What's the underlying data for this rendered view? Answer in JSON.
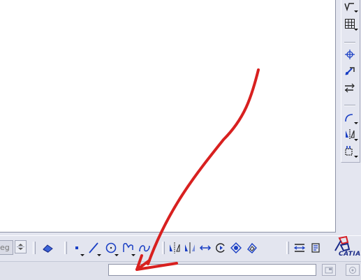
{
  "window": {
    "background": "#e3e5ef",
    "canvas_color": "#ffffff"
  },
  "unit_field": {
    "value": "eg"
  },
  "right_toolbar": {
    "items": [
      {
        "icon": "sketch-analysis-icon"
      },
      {
        "icon": "grid-icon"
      },
      {
        "icon": "point-snap-icon"
      },
      {
        "icon": "construction-element-icon"
      },
      {
        "icon": "geometrical-constraints-icon"
      },
      {
        "icon": "corner-icon"
      },
      {
        "icon": "mirror-icon"
      },
      {
        "icon": "project-3d-elements-icon"
      }
    ]
  },
  "bottom_toolbar": {
    "items": [
      {
        "icon": "eraser-icon"
      },
      {
        "icon": "point-icon"
      },
      {
        "icon": "line-icon"
      },
      {
        "icon": "circle-icon"
      },
      {
        "icon": "profile-icon"
      },
      {
        "icon": "spline-icon"
      },
      {
        "icon": "symmetry-icon"
      },
      {
        "icon": "mirror-axis-icon"
      },
      {
        "icon": "translate-icon"
      },
      {
        "icon": "rotate-icon"
      },
      {
        "icon": "scale-icon"
      },
      {
        "icon": "offset-icon"
      },
      {
        "icon": "constraint-dimension-icon"
      },
      {
        "icon": "auto-constraint-icon"
      }
    ]
  },
  "status_bar": {
    "command_value": "",
    "command_placeholder": ""
  },
  "logo": {
    "text": "CATIA",
    "brand_color": "#1a2a88",
    "accent_color": "#d61f26"
  },
  "annotation": {
    "color": "#d8201f"
  }
}
